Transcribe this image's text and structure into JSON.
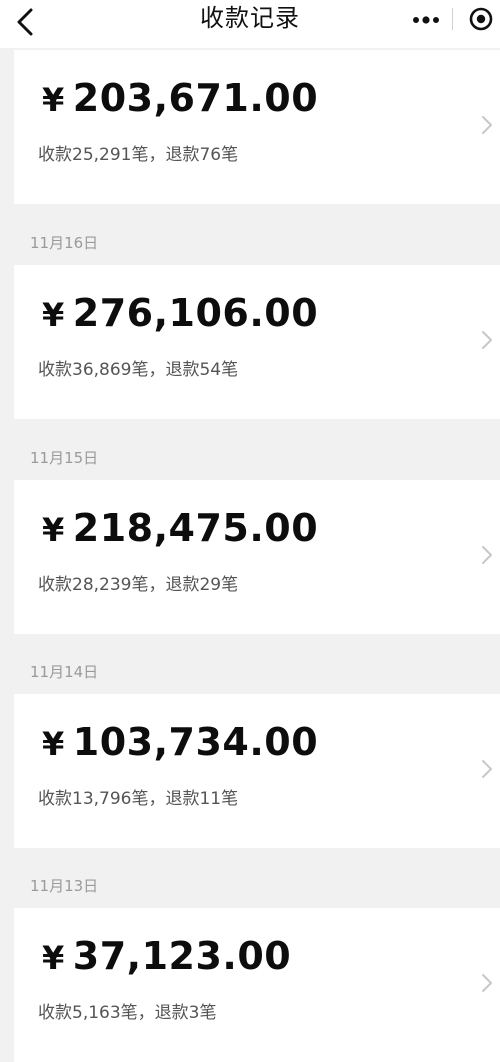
{
  "header": {
    "title": "收款记录"
  },
  "records": [
    {
      "date": "",
      "amount": "203,671.00",
      "summary": "收款25,291笔，退款76笔"
    },
    {
      "date": "11月16日",
      "amount": "276,106.00",
      "summary": "收款36,869笔，退款54笔"
    },
    {
      "date": "11月15日",
      "amount": "218,475.00",
      "summary": "收款28,239笔，退款29笔"
    },
    {
      "date": "11月14日",
      "amount": "103,734.00",
      "summary": "收款13,796笔，退款11笔"
    },
    {
      "date": "11月13日",
      "amount": "37,123.00",
      "summary": "收款5,163笔，退款3笔"
    }
  ],
  "currency_symbol": "¥",
  "icons": {
    "back": "back-chevron-icon",
    "more": "more-dots-icon",
    "close": "mini-program-close-icon",
    "row_chevron": "chevron-right-icon"
  }
}
